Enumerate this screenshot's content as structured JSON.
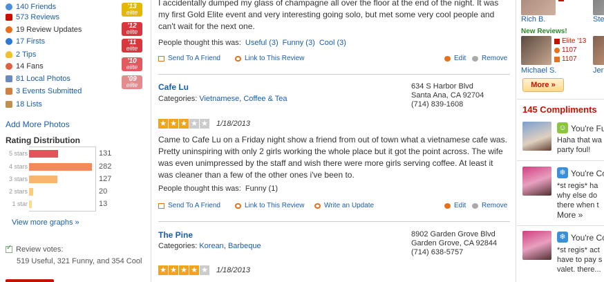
{
  "left": {
    "stats": [
      {
        "icon": "friends-icon",
        "label": "140 Friends",
        "color": "#4a90d9"
      },
      {
        "icon": "reviews-icon",
        "label": "573 Reviews",
        "color": "#c41200"
      },
      {
        "icon": "review-updates-icon",
        "label": "19 Review Updates",
        "color": "#e8701a"
      },
      {
        "icon": "firsts-icon",
        "label": "17 Firsts",
        "color": "#2a7ad5"
      },
      {
        "icon": "tips-icon",
        "label": "2 Tips",
        "color": "#f0c030"
      },
      {
        "icon": "fans-icon",
        "label": "14 Fans",
        "color": "#e06040"
      },
      {
        "icon": "local-photos-icon",
        "label": "81 Local Photos",
        "color": "#6a8ac0"
      },
      {
        "icon": "events-icon",
        "label": "3 Events Submitted",
        "color": "#d08040"
      },
      {
        "icon": "lists-icon",
        "label": "18 Lists",
        "color": "#c09050"
      }
    ],
    "elite_badges": [
      {
        "year": "'13",
        "word": "elite",
        "color": "#e5b800"
      },
      {
        "year": "'12",
        "word": "elite",
        "color": "#d9363e"
      },
      {
        "year": "'11",
        "word": "elite",
        "color": "#d9363e"
      },
      {
        "year": "'10",
        "word": "elite",
        "color": "#e05a5f"
      },
      {
        "year": "'09",
        "word": "elite",
        "color": "#e58a8d"
      }
    ],
    "add_photos": "Add More Photos",
    "rating_title": "Rating Distribution",
    "rating_distribution": [
      {
        "label": "5 stars",
        "count": 131,
        "color": "#e0555a"
      },
      {
        "label": "4 stars",
        "count": 282,
        "color": "#f48a5c"
      },
      {
        "label": "3 stars",
        "count": 127,
        "color": "#f8b56e"
      },
      {
        "label": "2 stars",
        "count": 20,
        "color": "#f9cd7a"
      },
      {
        "label": "1 star",
        "count": 13,
        "color": "#fbdd8f"
      }
    ],
    "rating_max": 300,
    "view_graphs": "View more graphs »",
    "votes_title": "Review votes:",
    "votes_text": "519 Useful, 321 Funny, and 354 Cool"
  },
  "main": {
    "review1": {
      "body": "I accidentally dumped my glass of champagne all over the floor at the end of the night. It was my first Gold Elite event and very interesting going solo, but met some very cool people and can't wait for the next one.",
      "people_label": "People thought this was:",
      "votes": [
        "Useful (3)",
        "Funny (3)",
        "Cool (3)"
      ],
      "actions": {
        "send": "Send To A Friend",
        "link": "Link to This Review",
        "edit": "Edit",
        "remove": "Remove"
      }
    },
    "review2": {
      "business": "Cafe Lu",
      "categories_label": "Categories:",
      "categories": [
        "Vietnamese",
        "Coffee & Tea"
      ],
      "address": [
        "634 S Harbor Blvd",
        "Santa Ana, CA 92704",
        "(714) 839-1608"
      ],
      "rating": 3,
      "date": "1/18/2013",
      "body": "Came to Cafe Lu on a Friday night  show a friend from out of town what a vietnamese cafe was. Pretty uninspiring with only 2 girls working the whole place but it got the point across. The wife was even unimpressed by the staff and wish there were more girls serving coffee. At least it was cleaner than a few of the other ones i've been to.",
      "people_label": "People thought this was:",
      "votes": [
        "Funny (1)"
      ],
      "actions": {
        "send": "Send To A Friend",
        "link": "Link to This Review",
        "update": "Write an Update",
        "edit": "Edit",
        "remove": "Remove"
      }
    },
    "review3": {
      "business": "The Pine",
      "categories_label": "Categories:",
      "categories": [
        "Korean",
        "Barbeque"
      ],
      "address": [
        "8902 Garden Grove Blvd",
        "Garden Grove, CA 92844",
        "(714) 638-5757"
      ],
      "rating": 4,
      "date": "1/18/2013"
    }
  },
  "right": {
    "top_user": {
      "name": "Rich B.",
      "name2": "Ste"
    },
    "new_reviews_label": "New Reviews!",
    "reviewer": {
      "name": "Michael S.",
      "elite": "Elite '13",
      "friends": "1107",
      "reviews": "1107",
      "name2": "Jer"
    },
    "more_button": "More »",
    "compliments_title": "145 Compliments",
    "compliments": [
      {
        "icon": "smiley-icon",
        "icon_color": "#8cc63f",
        "from": "You're Fun",
        "lines": [
          "Haha that wa",
          "party foul!"
        ]
      },
      {
        "icon": "snowflake-icon",
        "icon_color": "#3a8fd9",
        "from": "You're Co",
        "lines": [
          "*st regis* ha",
          "why else do",
          "there when t"
        ],
        "more": "More »"
      },
      {
        "icon": "snowflake-icon",
        "icon_color": "#3a8fd9",
        "from": "You're Co",
        "lines": [
          "*st regis* act",
          "have to pay s",
          "valet. there..."
        ]
      }
    ]
  }
}
